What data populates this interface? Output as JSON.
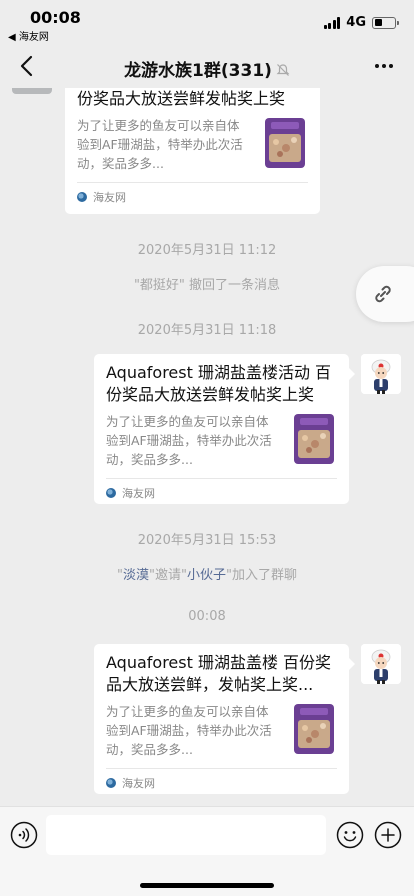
{
  "status_bar": {
    "time": "00:08",
    "back_app": "◀ 海友网",
    "network": "4G"
  },
  "nav": {
    "title": "龙游水族1群(331)"
  },
  "messages": [
    {
      "title": "Aquaforest 珊湖盐盖楼活动 百份奖品大放送尝鲜发帖奖上奖",
      "description": "为了让更多的鱼友可以亲自体验到AF珊湖盐，特举办此次活动，奖品多多...",
      "source": "海友网"
    },
    {
      "title": "Aquaforest 珊湖盐盖楼活动 百份奖品大放送尝鲜发帖奖上奖",
      "description": "为了让更多的鱼友可以亲自体验到AF珊湖盐，特举办此次活动，奖品多多...",
      "source": "海友网"
    },
    {
      "title": "Aquaforest 珊湖盐盖楼 百份奖品大放送尝鲜，发帖奖上奖...",
      "description": "为了让更多的鱼友可以亲自体验到AF珊湖盐，特举办此次活动，奖品多多...",
      "source": "海友网"
    }
  ],
  "timestamps": [
    "2020年5月31日 11:12",
    "2020年5月31日 11:18",
    "2020年5月31日 15:53",
    "00:08"
  ],
  "system": {
    "recall": "\"都挺好\" 撤回了一条消息",
    "invite_prefix": "\"",
    "inviter": "淡漠",
    "invite_mid": "\"邀请\"",
    "invitee": "小伙子",
    "invite_suffix": "\"加入了群聊"
  },
  "input": {
    "value": ""
  },
  "colors": {
    "background": "#ededed",
    "link": "#576b95",
    "muted_text": "#a8a8a8"
  }
}
